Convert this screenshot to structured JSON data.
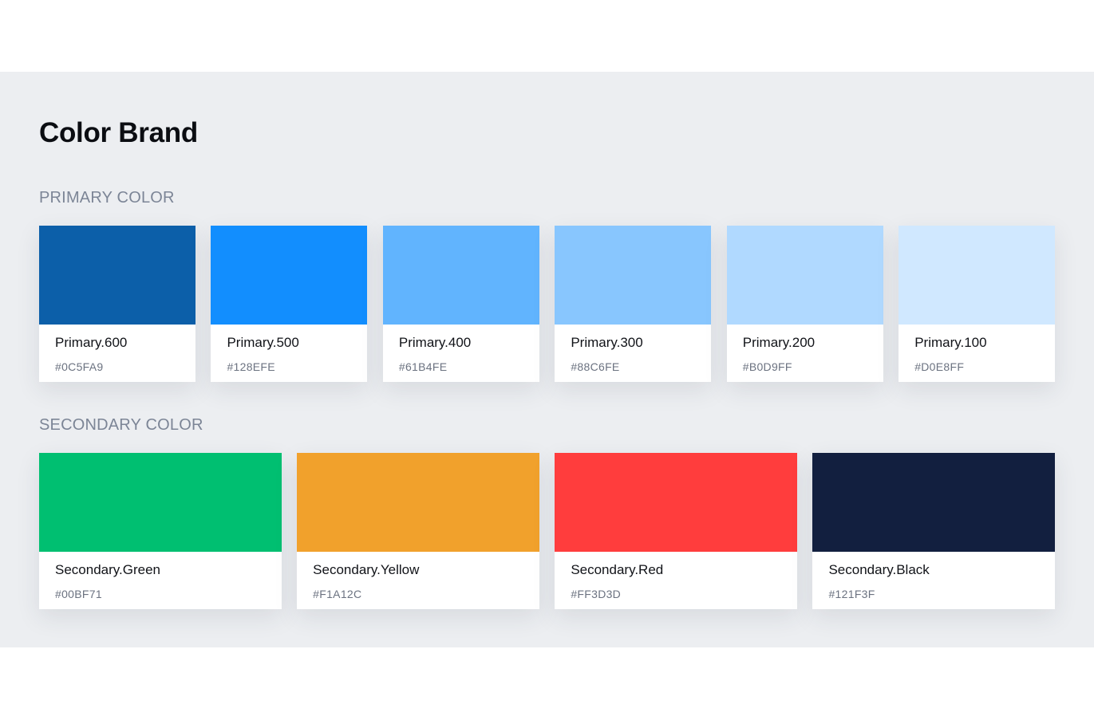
{
  "page": {
    "title": "Color Brand"
  },
  "primary": {
    "label": "PRIMARY COLOR",
    "items": [
      {
        "name": "Primary.600",
        "hex": "#0C5FA9",
        "color": "#0C5FA9"
      },
      {
        "name": "Primary.500",
        "hex": "#128EFE",
        "color": "#128EFE"
      },
      {
        "name": "Primary.400",
        "hex": "#61B4FE",
        "color": "#61B4FE"
      },
      {
        "name": "Primary.300",
        "hex": "#88C6FE",
        "color": "#88C6FE"
      },
      {
        "name": "Primary.200",
        "hex": "#B0D9FF",
        "color": "#B0D9FF"
      },
      {
        "name": "Primary.100",
        "hex": "#D0E8FF",
        "color": "#D0E8FF"
      }
    ]
  },
  "secondary": {
    "label": "SECONDARY COLOR",
    "items": [
      {
        "name": "Secondary.Green",
        "hex": "#00BF71",
        "color": "#00BF71"
      },
      {
        "name": "Secondary.Yellow",
        "hex": "#F1A12C",
        "color": "#F1A12C"
      },
      {
        "name": "Secondary.Red",
        "hex": "#FF3D3D",
        "color": "#FF3D3D"
      },
      {
        "name": "Secondary.Black",
        "hex": "#121F3F",
        "color": "#121F3F"
      }
    ]
  }
}
